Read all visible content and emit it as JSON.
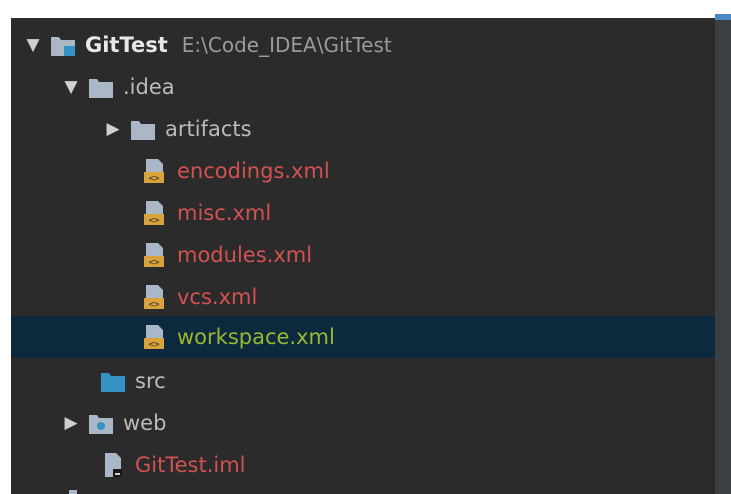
{
  "project_tree": {
    "root": {
      "name": "GitTest",
      "path": "E:\\Code_IDEA\\GitTest"
    },
    "idea": {
      "name": ".idea"
    },
    "artifacts": {
      "name": "artifacts"
    },
    "files_idea": [
      {
        "name": "encodings.xml"
      },
      {
        "name": "misc.xml"
      },
      {
        "name": "modules.xml"
      },
      {
        "name": "vcs.xml"
      },
      {
        "name": "workspace.xml"
      }
    ],
    "src": {
      "name": "src"
    },
    "web": {
      "name": "web"
    },
    "iml": {
      "name": "GitTest.iml"
    }
  },
  "colors": {
    "panel_bg": "#2b2b2b",
    "selected_bg": "#0d293e",
    "modified_red": "#d25252",
    "modified_green": "#9ab832",
    "folder_gray": "#a9b7c6",
    "folder_blue": "#3592c4",
    "xml_badge": "#d9a23a"
  },
  "icons": {
    "module": "module-folder-icon",
    "folder": "folder-icon",
    "source_folder": "source-folder-icon",
    "web_folder": "web-folder-icon",
    "xml": "xml-file-icon",
    "iml": "iml-file-icon",
    "expanded": "triangle-down-icon",
    "collapsed": "triangle-right-icon"
  }
}
